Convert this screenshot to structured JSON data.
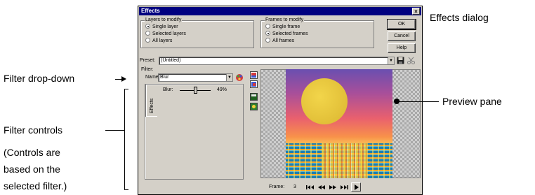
{
  "window": {
    "title": "Effects",
    "close_glyph": "×"
  },
  "layers_group": {
    "label": "Layers to modify",
    "options": [
      "Single layer",
      "Selected layers",
      "All layers"
    ],
    "selected": "Single layer"
  },
  "frames_group": {
    "label": "Frames to modify",
    "options": [
      "Single frame",
      "Selected frames",
      "All frames"
    ],
    "selected": "Selected frames"
  },
  "buttons": {
    "ok": "OK",
    "cancel": "Cancel",
    "help": "Help"
  },
  "preset": {
    "label": "Preset:",
    "value": "(Untitled)"
  },
  "filter": {
    "group_label": "Filter:",
    "name_label": "Name:",
    "name_value": "Blur"
  },
  "effects_tab": {
    "label": "Effects"
  },
  "blur_control": {
    "label": "Blur:",
    "value_text": "49%",
    "value": 49
  },
  "frame_controls": {
    "label": "Frame:",
    "value": "3"
  },
  "annotations": {
    "dialog_title": "Effects dialog",
    "filter_dropdown": "Filter drop-down",
    "preview_pane": "Preview pane",
    "filter_controls": "Filter controls",
    "note_lines": [
      "(Controls are",
      "based on the",
      "selected filter.)"
    ]
  },
  "icons": {
    "dropdown_arrow": "▼",
    "save_preset": "floppy-icon",
    "delete_preset": "scissors-icon",
    "filter_browse": "filter-palette-icon",
    "nav": [
      "first-frame-icon",
      "prev-frame-icon",
      "next-frame-icon",
      "last-frame-icon",
      "play-icon"
    ]
  }
}
